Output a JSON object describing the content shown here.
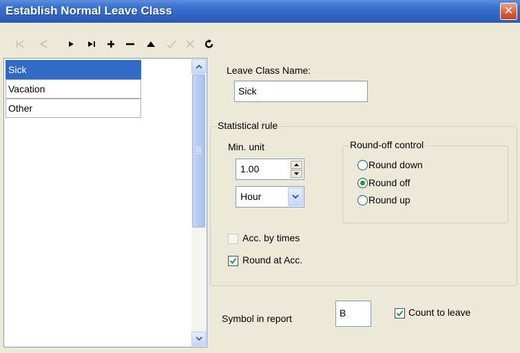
{
  "window": {
    "title": "Establish Normal Leave Class",
    "close_glyph": "✕"
  },
  "toolbar": {
    "buttons": [
      {
        "name": "first-record-icon",
        "enabled": false
      },
      {
        "name": "previous-record-icon",
        "enabled": false
      },
      {
        "name": "next-record-icon",
        "enabled": true
      },
      {
        "name": "last-record-icon",
        "enabled": true
      },
      {
        "name": "add-record-icon",
        "enabled": true
      },
      {
        "name": "delete-record-icon",
        "enabled": true
      },
      {
        "name": "edit-record-icon",
        "enabled": true
      },
      {
        "name": "post-record-icon",
        "enabled": false
      },
      {
        "name": "cancel-record-icon",
        "enabled": false
      },
      {
        "name": "refresh-icon",
        "enabled": true
      }
    ]
  },
  "leave_list": {
    "items": [
      "Sick",
      "Vacation",
      "Other"
    ],
    "selected": "Sick"
  },
  "form": {
    "name_label": "Leave Class Name:",
    "name_value": "Sick",
    "statistical_rule": {
      "legend": "Statistical rule",
      "min_unit_label": "Min. unit",
      "min_unit_value": "1.00",
      "unit_value": "Hour",
      "round_off": {
        "legend": "Round-off control",
        "options": [
          "Round down",
          "Round off",
          "Round up"
        ],
        "selected": "Round off"
      },
      "acc_by_times": {
        "label": "Acc. by times",
        "checked": false,
        "enabled": false
      },
      "round_at_acc": {
        "label": "Round at Acc.",
        "checked": true
      }
    },
    "symbol_label": "Symbol in report",
    "symbol_value": "B",
    "count_to_leave": {
      "label": "Count to leave",
      "checked": true
    }
  },
  "colors": {
    "title_bar": "#2f64c4",
    "selection": "#316ac5",
    "window_bg": "#ece9d8",
    "radio_dot": "#21a121",
    "check_mark": "#21a121"
  }
}
